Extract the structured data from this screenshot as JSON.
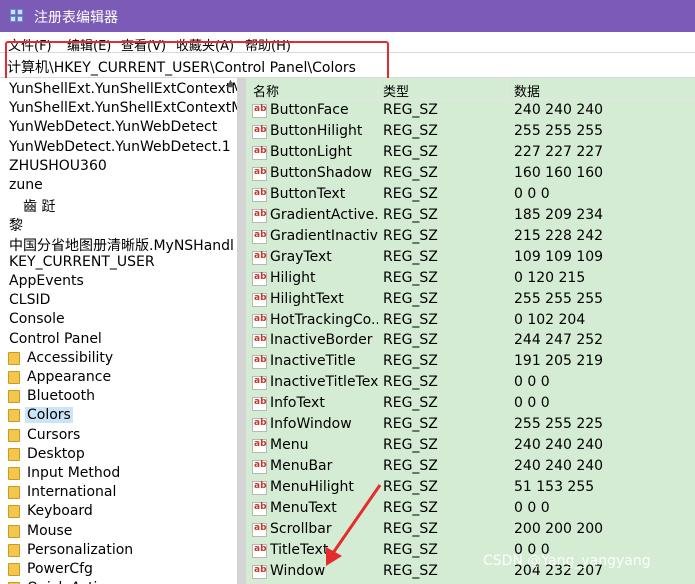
{
  "window": {
    "title": "注册表编辑器"
  },
  "menu": [
    "文件(F)",
    "编辑(E)",
    "查看(V)",
    "收藏夹(A)",
    "帮助(H)"
  ],
  "address": "计算机\\HKEY_CURRENT_USER\\Control Panel\\Colors",
  "tree": [
    {
      "label": "YunShellExt.YunShellExtContextM",
      "folder": false
    },
    {
      "label": "YunShellExt.YunShellExtContextM",
      "folder": false
    },
    {
      "label": "YunWebDetect.YunWebDetect",
      "folder": false
    },
    {
      "label": "YunWebDetect.YunWebDetect.1",
      "folder": false
    },
    {
      "label": "ZHUSHOU360",
      "folder": false
    },
    {
      "label": "zune",
      "folder": false
    },
    {
      "label": "　齒 跹",
      "folder": false
    },
    {
      "label": "黎",
      "folder": false
    },
    {
      "label": "中国分省地图册清晰版.MyNSHandl",
      "folder": false
    },
    {
      "label": "KEY_CURRENT_USER",
      "folder": false
    },
    {
      "label": "AppEvents",
      "folder": false
    },
    {
      "label": "CLSID",
      "folder": false
    },
    {
      "label": "Console",
      "folder": false
    },
    {
      "label": "Control Panel",
      "folder": false
    },
    {
      "label": "Accessibility",
      "folder": true
    },
    {
      "label": "Appearance",
      "folder": true
    },
    {
      "label": "Bluetooth",
      "folder": true
    },
    {
      "label": "Colors",
      "folder": true,
      "selected": true
    },
    {
      "label": "Cursors",
      "folder": true
    },
    {
      "label": "Desktop",
      "folder": true
    },
    {
      "label": "Input Method",
      "folder": true
    },
    {
      "label": "International",
      "folder": true
    },
    {
      "label": "Keyboard",
      "folder": true
    },
    {
      "label": "Mouse",
      "folder": true
    },
    {
      "label": "Personalization",
      "folder": true
    },
    {
      "label": "PowerCfg",
      "folder": true
    },
    {
      "label": "Quick Actions",
      "folder": true
    }
  ],
  "columns": {
    "name": "名称",
    "type": "类型",
    "data": "数据"
  },
  "values": [
    {
      "name": "ButtonFace",
      "type": "REG_SZ",
      "data": "240 240 240"
    },
    {
      "name": "ButtonHilight",
      "type": "REG_SZ",
      "data": "255 255 255"
    },
    {
      "name": "ButtonLight",
      "type": "REG_SZ",
      "data": "227 227 227"
    },
    {
      "name": "ButtonShadow",
      "type": "REG_SZ",
      "data": "160 160 160"
    },
    {
      "name": "ButtonText",
      "type": "REG_SZ",
      "data": "0 0 0"
    },
    {
      "name": "GradientActive...",
      "type": "REG_SZ",
      "data": "185 209 234"
    },
    {
      "name": "GradientInactiv...",
      "type": "REG_SZ",
      "data": "215 228 242"
    },
    {
      "name": "GrayText",
      "type": "REG_SZ",
      "data": "109 109 109"
    },
    {
      "name": "Hilight",
      "type": "REG_SZ",
      "data": "0 120 215"
    },
    {
      "name": "HilightText",
      "type": "REG_SZ",
      "data": "255 255 255"
    },
    {
      "name": "HotTrackingCo...",
      "type": "REG_SZ",
      "data": "0 102 204"
    },
    {
      "name": "InactiveBorder",
      "type": "REG_SZ",
      "data": "244 247 252"
    },
    {
      "name": "InactiveTitle",
      "type": "REG_SZ",
      "data": "191 205 219"
    },
    {
      "name": "InactiveTitleText",
      "type": "REG_SZ",
      "data": "0 0 0"
    },
    {
      "name": "InfoText",
      "type": "REG_SZ",
      "data": "0 0 0"
    },
    {
      "name": "InfoWindow",
      "type": "REG_SZ",
      "data": "255 255 225"
    },
    {
      "name": "Menu",
      "type": "REG_SZ",
      "data": "240 240 240"
    },
    {
      "name": "MenuBar",
      "type": "REG_SZ",
      "data": "240 240 240"
    },
    {
      "name": "MenuHilight",
      "type": "REG_SZ",
      "data": "51 153 255"
    },
    {
      "name": "MenuText",
      "type": "REG_SZ",
      "data": "0 0 0"
    },
    {
      "name": "Scrollbar",
      "type": "REG_SZ",
      "data": "200 200 200"
    },
    {
      "name": "TitleText",
      "type": "REG_SZ",
      "data": "0 0 0"
    },
    {
      "name": "Window",
      "type": "REG_SZ",
      "data": "204 232 207"
    }
  ],
  "watermark": "CSDN @Yang_yangyang",
  "colors": {
    "titlebar": "#7b5bb5",
    "list_bg": "#d5ecd4",
    "highlight_box": "#e52b2b",
    "selected": "#cce4f7"
  }
}
